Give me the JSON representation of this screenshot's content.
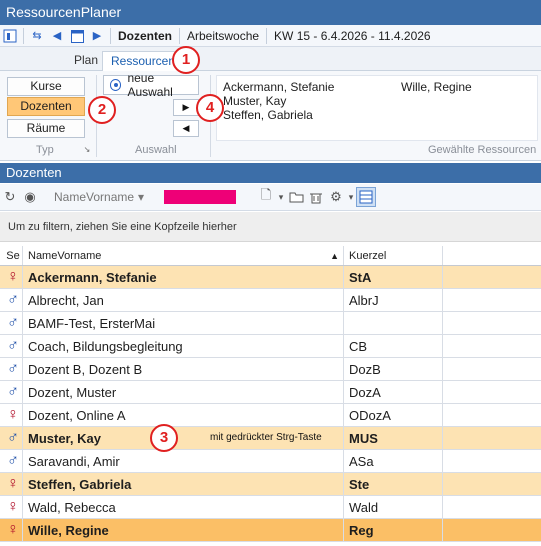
{
  "window": {
    "title": "RessourcenPlaner"
  },
  "toolbar": {
    "current_group": "Dozenten",
    "view_mode": "Arbeitswoche",
    "week_range": "KW 15 - 6.4.2026 - 11.4.2026"
  },
  "tabs": [
    {
      "label": "Plan"
    },
    {
      "label": "Ressourcen"
    }
  ],
  "ribbon": {
    "type_buttons": [
      "Kurse",
      "Dozenten",
      "Räume"
    ],
    "type_group_label": "Typ",
    "new_selection_label": "neue Auswahl",
    "selection_group_label": "Auswahl",
    "selected_resources_label": "Gewählte Ressourcen",
    "selected_resources": [
      "Ackermann, Stefanie",
      "Wille, Regine",
      "Muster, Kay",
      "Steffen, Gabriela"
    ]
  },
  "panel": {
    "title": "Dozenten"
  },
  "grid_tools": {
    "column_combo": "NameVorname"
  },
  "group_hint": "Um zu filtern, ziehen Sie eine Kopfzeile hierher",
  "grid": {
    "headers": {
      "sex": "Se",
      "name": "NameVorname",
      "code": "Kuerzel"
    },
    "rows": [
      {
        "sex": "♀",
        "name": "Ackermann, Stefanie",
        "code": "StA"
      },
      {
        "sex": "♂",
        "name": "Albrecht, Jan",
        "code": "AlbrJ"
      },
      {
        "sex": "♂",
        "name": "BAMF-Test, ErsterMai",
        "code": ""
      },
      {
        "sex": "♂",
        "name": "Coach, Bildungsbegleitung",
        "code": "CB"
      },
      {
        "sex": "♂",
        "name": "Dozent B, Dozent B",
        "code": "DozB"
      },
      {
        "sex": "♂",
        "name": "Dozent, Muster",
        "code": "DozA"
      },
      {
        "sex": "♀",
        "name": "Dozent, Online A",
        "code": "ODozA"
      },
      {
        "sex": "♂",
        "name": "Muster, Kay",
        "code": "MUS"
      },
      {
        "sex": "♂",
        "name": "Saravandi, Amir",
        "code": "ASa"
      },
      {
        "sex": "♀",
        "name": "Steffen, Gabriela",
        "code": "Ste"
      },
      {
        "sex": "♀",
        "name": "Wald, Rebecca",
        "code": "Wald"
      },
      {
        "sex": "♀",
        "name": "Wille, Regine",
        "code": "Reg"
      }
    ]
  },
  "annotations": {
    "badge1": "1",
    "badge2": "2",
    "badge3": "3",
    "badge4": "4",
    "ctrl_hint": "mit gedrückter Strg-Taste"
  },
  "colors": {
    "accent": "#3c6ea8",
    "selection": "#fbbf66",
    "selection_light": "#fde3b3",
    "badge": "#e02020"
  }
}
